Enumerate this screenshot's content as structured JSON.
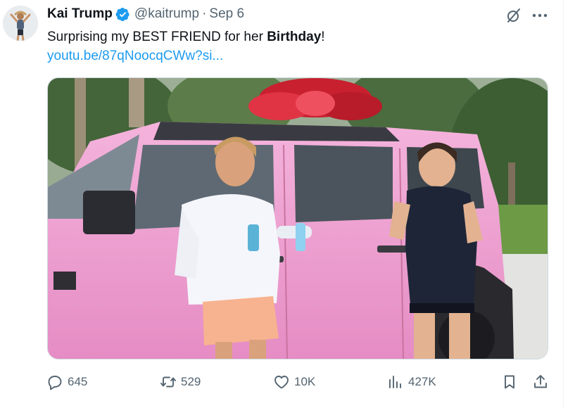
{
  "tweet": {
    "author": {
      "display_name": "Kai Trump",
      "handle": "@kaitrump",
      "verified": true,
      "avatar_icon": "profile-photo"
    },
    "separator": "·",
    "timestamp": "Sep 6",
    "text": {
      "part1": "Surprising my BEST FRIEND for her ",
      "bold": "Birthday",
      "part2": "!"
    },
    "link": "youtu.be/87qNoocqCWw?si...",
    "media": {
      "description_icon": "photo",
      "colors": {
        "car": "#f1a3d3",
        "bow": "#d8283a",
        "sky": "#e9eef2"
      }
    },
    "actions": {
      "replies": "645",
      "reposts": "529",
      "likes": "10K",
      "views": "427K"
    }
  },
  "icons": {
    "verified": "verified-badge-icon",
    "grok": "grok-icon",
    "more": "more-icon",
    "reply": "reply-icon",
    "repost": "repost-icon",
    "like": "heart-icon",
    "views": "views-chart-icon",
    "bookmark": "bookmark-icon",
    "share": "share-icon"
  },
  "theme": {
    "accent": "#1d9bf0",
    "secondary_text": "#536471",
    "primary_text": "#0f1419"
  }
}
